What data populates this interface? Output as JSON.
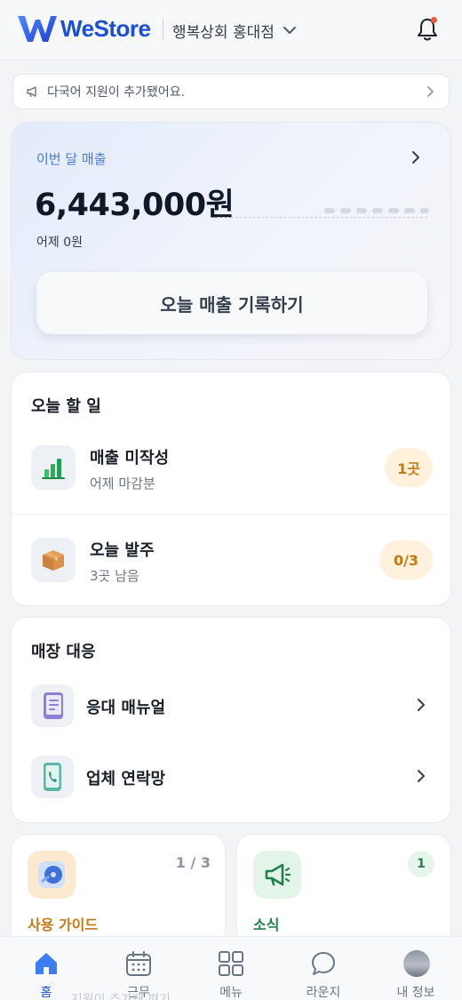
{
  "header": {
    "logo_text": "WeStore",
    "store_name": "행복상회 홍대점",
    "brand_color": "#1b4fd8",
    "notification_dot_color": "#f25c3b"
  },
  "notice": {
    "text": "다국어 지원이 추가됐어요.",
    "icon": "megaphone-icon"
  },
  "sales": {
    "label": "이번 달 매출",
    "amount": "6,443,000원",
    "yesterday": "어제 0원",
    "record_button": "오늘 매출 기록하기"
  },
  "todo": {
    "title": "오늘 할 일",
    "items": [
      {
        "name": "매출 미작성",
        "sub": "어제 마감분",
        "badge": "1곳",
        "icon": "bar-chart-icon"
      },
      {
        "name": "오늘 발주",
        "sub": "3곳 남음",
        "badge": "0/3",
        "icon": "package-icon"
      }
    ]
  },
  "store_response": {
    "title": "매장 대응",
    "items": [
      {
        "label": "응대 매뉴얼",
        "icon": "manual-icon"
      },
      {
        "label": "업체 연락망",
        "icon": "phone-icon"
      }
    ]
  },
  "guide": {
    "label": "사용 가이드",
    "count": "1 / 3",
    "color": "#c47a14"
  },
  "news": {
    "label": "소식",
    "badge": "1",
    "color": "#23814a"
  },
  "tabbar": {
    "ghost_text": "지원이 추가돼 펴기",
    "tabs": [
      {
        "label": "홈",
        "icon": "home-icon",
        "active": true
      },
      {
        "label": "근무",
        "icon": "calendar-icon",
        "active": false
      },
      {
        "label": "메뉴",
        "icon": "grid-icon",
        "active": false
      },
      {
        "label": "라운지",
        "icon": "chat-icon",
        "active": false
      },
      {
        "label": "내 정보",
        "icon": "avatar",
        "active": false
      }
    ]
  }
}
